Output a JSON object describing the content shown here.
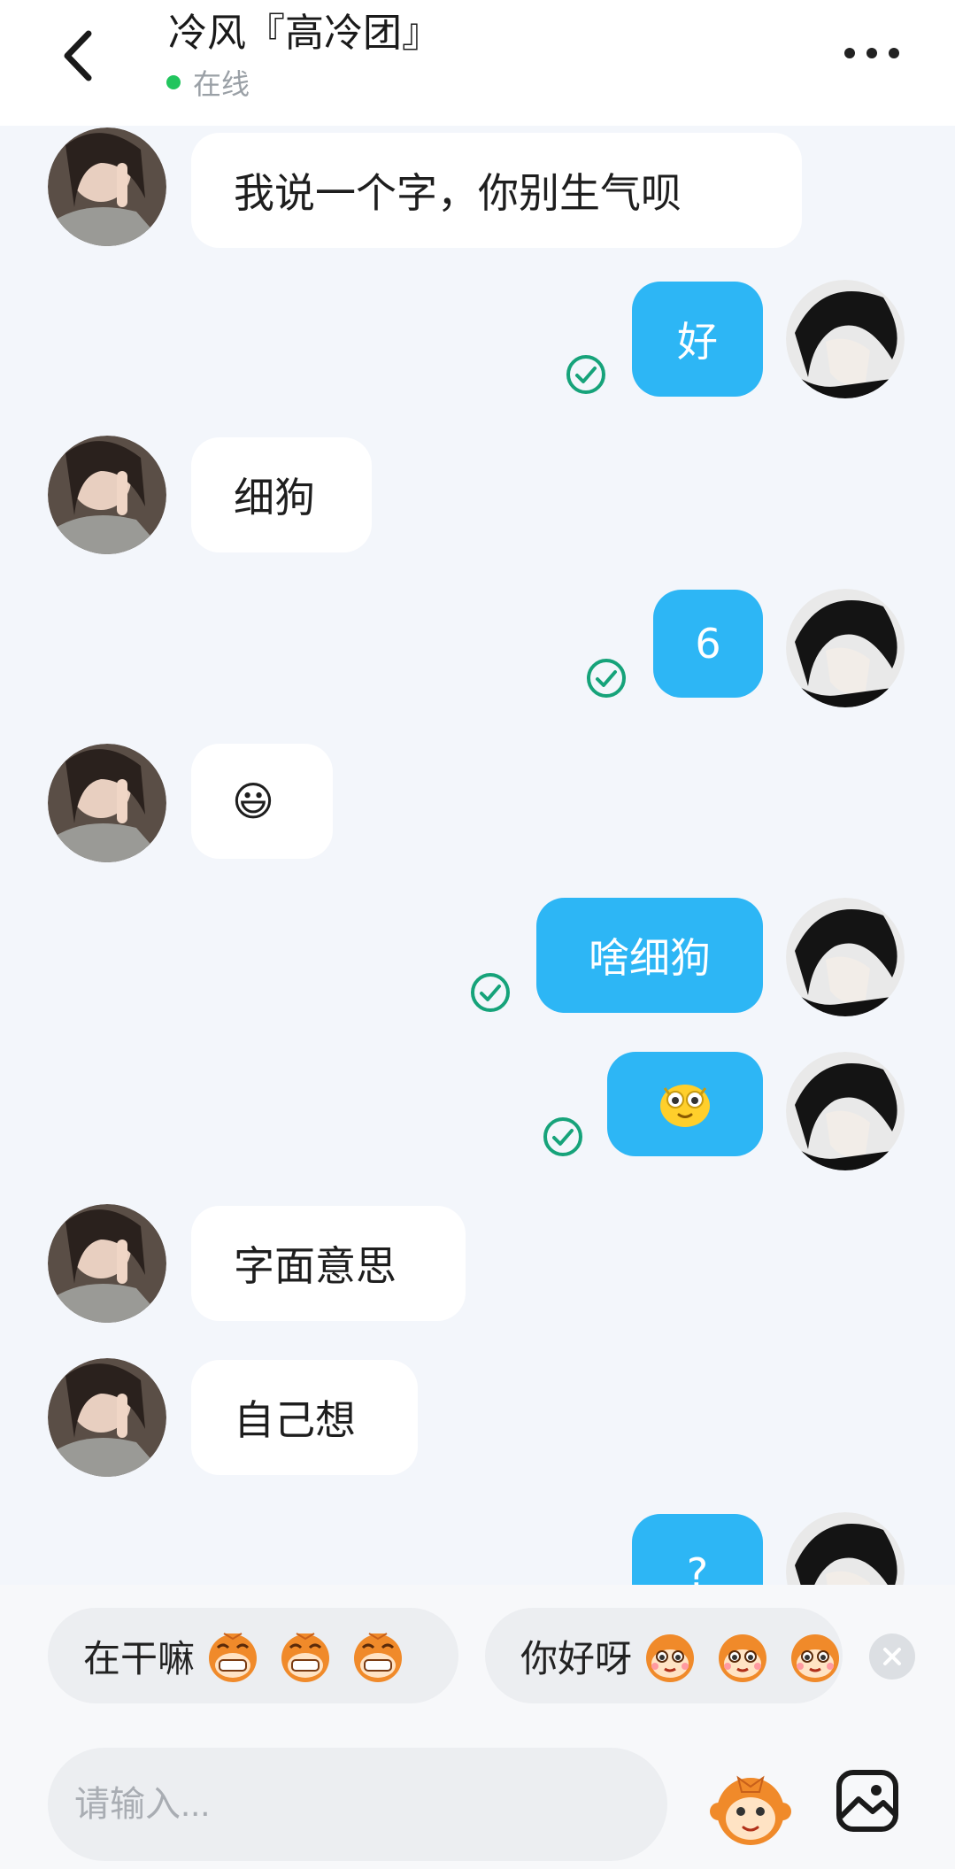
{
  "header": {
    "title": "冷风『高冷团』",
    "status_text": "在线",
    "status_color": "#22c55e",
    "back_icon": "chevron-left-icon",
    "more_icon": "more-dots-icon"
  },
  "messages": [
    {
      "from": "them",
      "text": "我说一个字，你别生气呗"
    },
    {
      "from": "me",
      "text": "好",
      "read": true
    },
    {
      "from": "them",
      "text": "细狗"
    },
    {
      "from": "me",
      "text": "6",
      "read": true
    },
    {
      "from": "them",
      "text": "😃"
    },
    {
      "from": "me",
      "text": "啥细狗",
      "read": true
    },
    {
      "from": "me",
      "sticker": "yellow-face-sticker",
      "read": true
    },
    {
      "from": "them",
      "text": "字面意思"
    },
    {
      "from": "them",
      "text": "自己想"
    },
    {
      "from": "me",
      "text": "?"
    }
  ],
  "quick_replies": [
    {
      "text": "在干嘛",
      "emoji": "grinning-monkey-emoji"
    },
    {
      "text": "你好呀",
      "emoji": "smiling-monkey-emoji"
    }
  ],
  "input": {
    "placeholder": "请输入..."
  },
  "colors": {
    "accent": "#2db6f5",
    "background": "#f3f6fb",
    "check": "#16a37a"
  }
}
